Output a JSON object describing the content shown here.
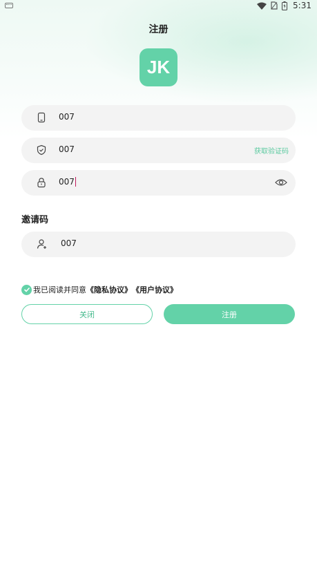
{
  "status_bar": {
    "time": "5:31",
    "icons": [
      "keyboard-icon",
      "wifi-icon",
      "no-sim-icon",
      "battery-icon"
    ]
  },
  "header": {
    "title": "注册"
  },
  "logo": {
    "text": "JK",
    "color": "#63d2a8"
  },
  "form": {
    "phone": {
      "value": "007",
      "icon": "phone-icon"
    },
    "code": {
      "value": "007",
      "icon": "shield-icon",
      "action_label": "获取验证码"
    },
    "password": {
      "value": "007",
      "icon": "lock-icon",
      "toggle_icon": "eye-icon"
    },
    "invite_label": "邀请码",
    "invite": {
      "value": "007",
      "icon": "add-user-icon"
    }
  },
  "agreement": {
    "checked": true,
    "prefix": "我已阅读并同意",
    "privacy": "《隐私协议》",
    "user": "《用户协议》"
  },
  "buttons": {
    "close": "关闭",
    "register": "注册"
  },
  "colors": {
    "accent": "#63d2a8",
    "field_bg": "#f3f3f3",
    "caret": "#c2185b"
  }
}
